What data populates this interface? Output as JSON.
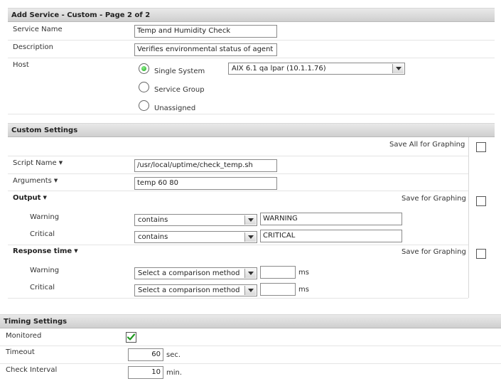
{
  "page_title": "Add Service - Custom - Page 2 of 2",
  "service": {
    "name_label": "Service Name",
    "name_value": "Temp and Humidity Check",
    "description_label": "Description",
    "description_value": "Verifies environmental status of agent",
    "host_label": "Host",
    "host_options": [
      {
        "label": "Single System",
        "selected": true
      },
      {
        "label": "Service Group",
        "selected": false
      },
      {
        "label": "Unassigned",
        "selected": false
      }
    ],
    "host_select_value": "AIX 6.1 qa lpar (10.1.1.76)"
  },
  "custom": {
    "title": "Custom Settings",
    "save_all_label": "Save All for Graphing",
    "save_all_checked": false,
    "script_label": "Script Name",
    "script_value": "/usr/local/uptime/check_temp.sh",
    "args_label": "Arguments",
    "args_value": "temp 60 80",
    "output_label": "Output",
    "output_save_label": "Save for Graphing",
    "output_save_checked": false,
    "output_warning_label": "Warning",
    "output_warning_op": "contains",
    "output_warning_value": "WARNING",
    "output_critical_label": "Critical",
    "output_critical_op": "contains",
    "output_critical_value": "CRITICAL",
    "response_label": "Response time",
    "response_save_label": "Save for Graphing",
    "response_save_checked": false,
    "response_warning_label": "Warning",
    "response_warning_op": "Select a comparison method",
    "response_warning_value": "",
    "response_warning_unit": "ms",
    "response_critical_label": "Critical",
    "response_critical_op": "Select a comparison method",
    "response_critical_value": "",
    "response_critical_unit": "ms"
  },
  "timing": {
    "title": "Timing Settings",
    "monitored_label": "Monitored",
    "monitored_checked": true,
    "timeout_label": "Timeout",
    "timeout_value": "60",
    "timeout_unit": "sec.",
    "interval_label": "Check Interval",
    "interval_value": "10",
    "interval_unit": "min."
  },
  "colors": {
    "header_top": "#e9e9e9",
    "header_bottom": "#cfcfcf",
    "radio_selected": "#1aa51a",
    "checkmark": "#1f9a1f"
  },
  "icons": [
    "radio-selected-icon",
    "radio-empty-icon",
    "dropdown-arrow-icon",
    "caret-down-icon",
    "checkmark-icon"
  ]
}
